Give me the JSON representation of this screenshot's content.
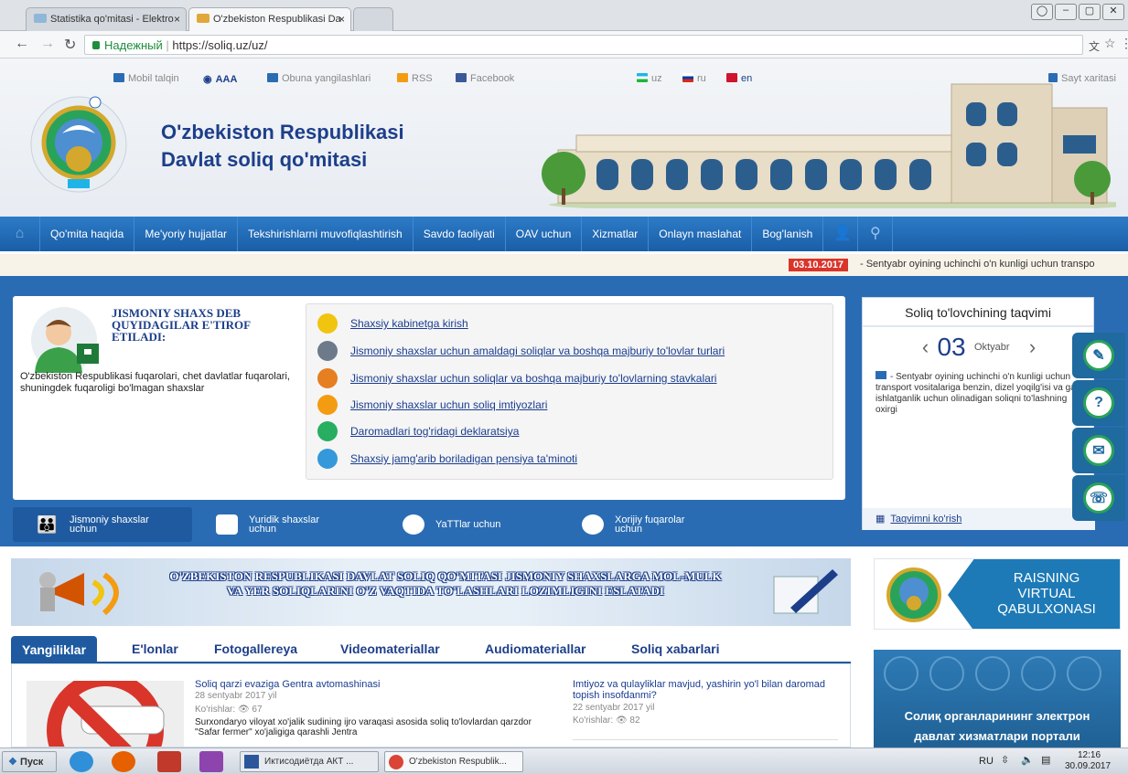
{
  "browser": {
    "tabs": [
      {
        "label": "Statistika qo'mitasi - Elektro"
      },
      {
        "label": "O'zbekiston Respublikasi Da"
      }
    ],
    "secure_label": "Надежный",
    "url": "https://soliq.uz/uz/"
  },
  "header": {
    "top_links": [
      "Mobil talqin",
      "AAA",
      "Obuna yangilashlari",
      "RSS",
      "Facebook"
    ],
    "languages": [
      "uz",
      "ru",
      "en"
    ],
    "sitemap": "Sayt xaritasi",
    "title_line1": "O'zbekiston Respublikasi",
    "title_line2": "Davlat soliq qo'mitasi"
  },
  "nav": {
    "items": [
      "Qo'mita haqida",
      "Me'yoriy hujjatlar",
      "Tekshirishlarni muvofiqlashtirish",
      "Savdo faoliyati",
      "OAV uchun",
      "Xizmatlar",
      "Onlayn maslahat",
      "Bog'lanish"
    ]
  },
  "ticker": {
    "date": "03.10.2017",
    "text": "- Sentyabr oyining uchinchi o'n kunligi uchun transpo"
  },
  "individuals": {
    "heading": "JISMONIY SHAXS DEB QUYIDAGILAR E'TIROF ETILADI:",
    "description": "O'zbekiston Respublikasi fuqarolari, chet davlatlar fuqarolari, shuningdek fuqaroligi bo'lmagan shaxslar",
    "links": [
      "Shaxsiy kabinetga kirish",
      "Jismoniy shaxslar uchun amaldagi soliqlar va boshqa majburiy to'lovlar turlari",
      "Jismoniy shaxslar uchun soliqlar va boshqa majburiy to'lovlarning stavkalari",
      "Jismoniy shaxslar uchun soliq imtiyozlari",
      "Daromadlari tog'ridagi deklaratsiya",
      "Shaxsiy jamg'arib boriladigan pensiya ta'minoti"
    ]
  },
  "audience_tabs": [
    {
      "line1": "Jismoniy shaxslar",
      "line2": "uchun"
    },
    {
      "line1": "Yuridik shaxslar",
      "line2": "uchun"
    },
    {
      "line1": "YaTTlar uchun",
      "line2": ""
    },
    {
      "line1": "Xorijiy fuqarolar",
      "line2": "uchun"
    }
  ],
  "calendar": {
    "title": "Soliq to'lovchining taqvimi",
    "day": "03",
    "month": "Oktyabr",
    "text": "- Sentyabr oyining uchinchi o'n kunligi uchun transport vositalariga benzin, dizel yoqilg'isi va gaz ishlatganlik uchun olinadigan soliqni to'lashning oxirgi",
    "footer_link": "Taqvimni ko'rish"
  },
  "banner": {
    "text": "O'ZBEKISTON RESPUBLIKASI DAVLAT SOLIQ QO'MITASI JISMONIY SHAXSLARGA MOL-MULK VA YER SOLIQLARINI O'Z VAQTIDA TO'LASHLARI LOZIMLIGINI ESLATADI"
  },
  "raisning": {
    "line1": "RAISNING",
    "line2": "VIRTUAL",
    "line3": "QABULXONASI"
  },
  "news_tabs": [
    "Yangiliklar",
    "E'lonlar",
    "Fotogallereya",
    "Videomateriallar",
    "Audiomateriallar",
    "Soliq xabarlari"
  ],
  "news": [
    {
      "title": "Soliq qarzi evaziga Gentra avtomashinasi",
      "date": "28 sentyabr 2017 yil",
      "views_label": "Ko'rishlar:",
      "views": "67",
      "body": "Surxondaryo viloyat xo'jalik sudining ijro varaqasi asosida soliq to'lovlardan qarzdor \"Safar fermer\" xo'jaligiga qarashli Jentra"
    },
    {
      "title": "Imtiyoz va qulayliklar mavjud, yashirin yo'l bilan daromad topish insofdanmi?",
      "date": "22 sentyabr 2017 yil",
      "views_label": "Ko'rishlar:",
      "views": "82"
    }
  ],
  "portal": {
    "line1": "Солиқ органларининг электрон",
    "line2": "давлат хизматлари портали"
  },
  "taskbar": {
    "start": "Пуск",
    "tasks": [
      "Иктисодиётда АКТ ...",
      "O'zbekiston Respublik..."
    ],
    "lang": "RU",
    "time": "12:16",
    "date": "30.09.2017"
  }
}
